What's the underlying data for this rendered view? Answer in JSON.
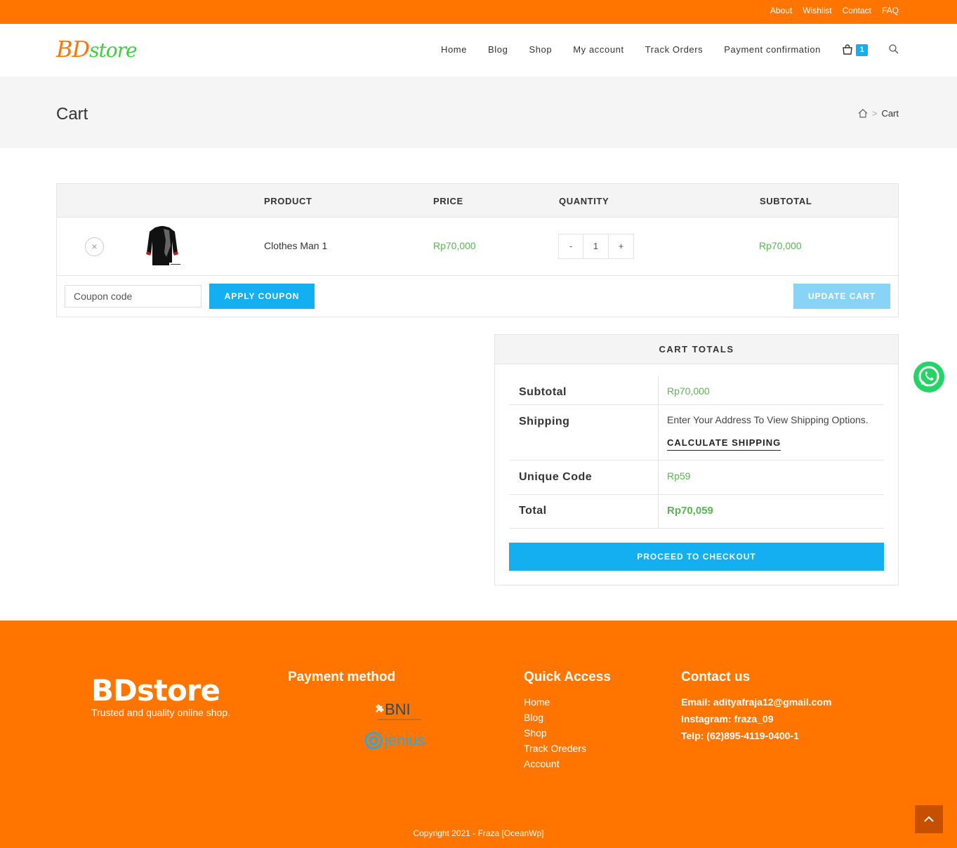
{
  "topbar": {
    "links": [
      "About",
      "Wishlist",
      "Contact",
      "FAQ"
    ]
  },
  "header": {
    "logo_part1": "BD",
    "logo_part2": "store",
    "nav": [
      "Home",
      "Blog",
      "Shop",
      "My account",
      "Track Orders",
      "Payment confirmation"
    ],
    "cart_count": "1"
  },
  "page": {
    "title": "Cart",
    "breadcrumb_current": "Cart",
    "breadcrumb_sep": ">"
  },
  "cart": {
    "columns": [
      "PRODUCT",
      "PRICE",
      "QUANTITY",
      "SUBTOTAL"
    ],
    "items": [
      {
        "remove": "×",
        "name": "Clothes Man 1",
        "price": "Rp70,000",
        "qty_minus": "-",
        "qty": "1",
        "qty_plus": "+",
        "subtotal": "Rp70,000"
      }
    ],
    "coupon_placeholder": "Coupon code",
    "apply_label": "APPLY COUPON",
    "update_label": "UPDATE CART"
  },
  "totals": {
    "heading": "CART TOTALS",
    "subtotal_label": "Subtotal",
    "subtotal_value": "Rp70,000",
    "shipping_label": "Shipping",
    "shipping_text": "Enter Your Address To View Shipping Options.",
    "calc_shipping": "CALCULATE SHIPPING",
    "unique_label": "Unique Code",
    "unique_value": "Rp59",
    "total_label": "Total",
    "total_value": "Rp70,059",
    "checkout_label": "PROCEED TO CHECKOUT"
  },
  "footer": {
    "logo": "BDstore",
    "tagline": "Trusted and quality online shop.",
    "payment_heading": "Payment method",
    "payment_logos": [
      "BNI",
      "jenius"
    ],
    "quick_heading": "Quick Access",
    "quick_links": [
      "Home",
      "Blog",
      "Shop",
      "Track Oreders",
      "Account"
    ],
    "contact_heading": "Contact us",
    "contact_lines": [
      "Email: adityafraja12@gmail.com",
      "Instagram: fraza_09",
      "Telp: (62)895-4119-0400-1"
    ],
    "copyright": "Copyright 2021 - Fraza [OceanWp]"
  },
  "colors": {
    "brand_orange": "#ff7500",
    "accent_blue": "#13aff0",
    "price_green": "#5ab552"
  }
}
